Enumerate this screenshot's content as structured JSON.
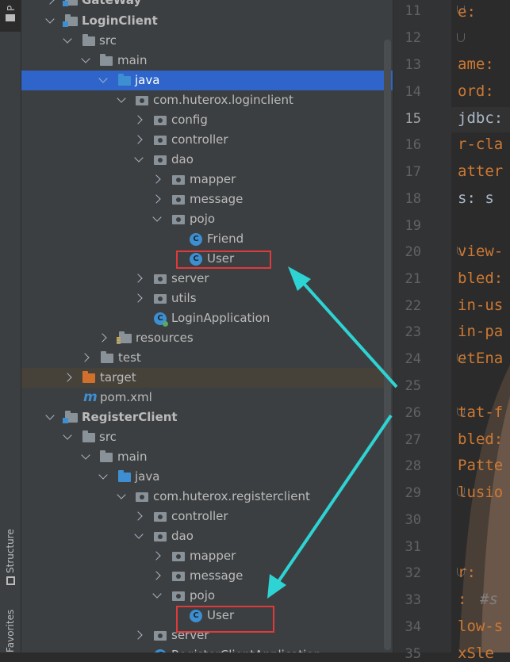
{
  "side_tabs": {
    "project": "P",
    "structure": "Structure",
    "favorites": "Favorites"
  },
  "tree": {
    "gateway": "GateWay",
    "login_client": "LoginClient",
    "src": "src",
    "main": "main",
    "java": "java",
    "login_pkg": "com.huterox.loginclient",
    "config": "config",
    "controller": "controller",
    "dao": "dao",
    "mapper": "mapper",
    "message": "message",
    "pojo": "pojo",
    "friend": "Friend",
    "user": "User",
    "server": "server",
    "utils": "utils",
    "login_app": "LoginApplication",
    "resources": "resources",
    "test": "test",
    "target": "target",
    "pom": "pom.xml",
    "register_client": "RegisterClient",
    "register_pkg": "com.huterox.registerclient",
    "register_app": "RegisterClientApplication"
  },
  "editor": {
    "line_numbers": [
      "11",
      "12",
      "13",
      "14",
      "15",
      "16",
      "17",
      "18",
      "19",
      "20",
      "21",
      "22",
      "23",
      "24",
      "25",
      "26",
      "27",
      "28",
      "29",
      "30",
      "31",
      "32",
      "33",
      "34",
      "35"
    ],
    "current_line": "15",
    "code": {
      "l11": "e:",
      "l13": "ame:",
      "l14": "ord:",
      "l15": "jdbc:",
      "l16": "r-cla",
      "l17": "atter",
      "l18": "s: s",
      "l20": "view-",
      "l21": "bled:",
      "l22": "in-us",
      "l23": "in-pa",
      "l24": "etEna",
      "l26": "tat-f",
      "l27": "bled:",
      "l28": "Patte",
      "l29": "lusio",
      "l32": "r:",
      "l33a": ":",
      "l33b": "#s",
      "l34": "low-s",
      "l35": "xSle"
    }
  },
  "colors": {
    "selection": "#2f65ca",
    "highlight_box": "#e03a3a",
    "arrow": "#2ed3d3"
  }
}
